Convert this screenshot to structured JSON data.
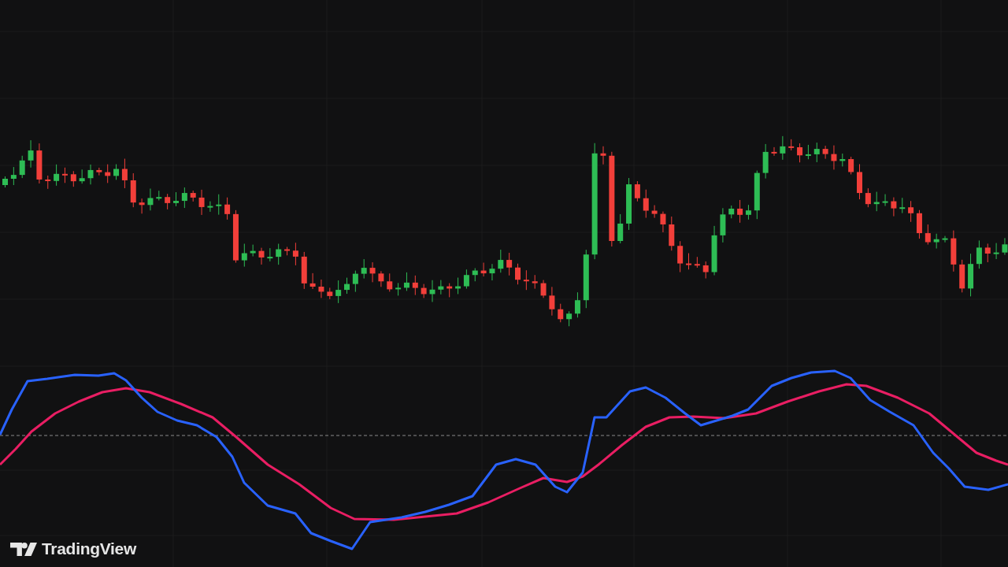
{
  "logo": {
    "text": "TradingView"
  }
}
